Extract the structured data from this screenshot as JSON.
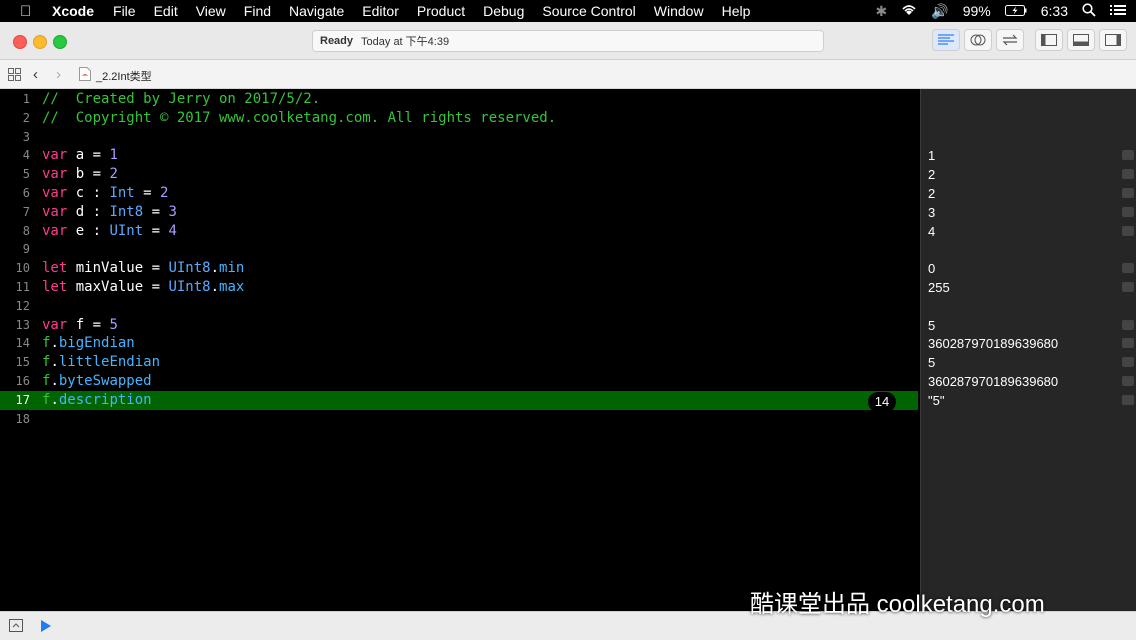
{
  "menubar": {
    "app": "Xcode",
    "items": [
      "File",
      "Edit",
      "View",
      "Find",
      "Navigate",
      "Editor",
      "Product",
      "Debug",
      "Source Control",
      "Window",
      "Help"
    ],
    "battery": "99%",
    "time": "6:33"
  },
  "titlebar": {
    "status_ready": "Ready",
    "status_time": "Today at 下午4:39"
  },
  "pathbar": {
    "file": "_2.2Int类型"
  },
  "lines": [
    {
      "n": "1",
      "tokens": [
        {
          "c": "cmt",
          "t": "//  Created by Jerry on 2017/5/2."
        }
      ]
    },
    {
      "n": "2",
      "tokens": [
        {
          "c": "cmt",
          "t": "//  Copyright © 2017 www.coolketang.com. All rights reserved."
        }
      ]
    },
    {
      "n": "3",
      "tokens": []
    },
    {
      "n": "4",
      "tokens": [
        {
          "c": "kw",
          "t": "var"
        },
        {
          "c": "ident",
          "t": " a = "
        },
        {
          "c": "num-l",
          "t": "1"
        }
      ]
    },
    {
      "n": "5",
      "tokens": [
        {
          "c": "kw",
          "t": "var"
        },
        {
          "c": "ident",
          "t": " b = "
        },
        {
          "c": "num-l",
          "t": "2"
        }
      ]
    },
    {
      "n": "6",
      "tokens": [
        {
          "c": "kw",
          "t": "var"
        },
        {
          "c": "ident",
          "t": " c : "
        },
        {
          "c": "type",
          "t": "Int"
        },
        {
          "c": "ident",
          "t": " = "
        },
        {
          "c": "num-l",
          "t": "2"
        }
      ]
    },
    {
      "n": "7",
      "tokens": [
        {
          "c": "kw",
          "t": "var"
        },
        {
          "c": "ident",
          "t": " d : "
        },
        {
          "c": "type",
          "t": "Int8"
        },
        {
          "c": "ident",
          "t": " = "
        },
        {
          "c": "num-l",
          "t": "3"
        }
      ]
    },
    {
      "n": "8",
      "tokens": [
        {
          "c": "kw",
          "t": "var"
        },
        {
          "c": "ident",
          "t": " e : "
        },
        {
          "c": "type",
          "t": "UInt"
        },
        {
          "c": "ident",
          "t": " = "
        },
        {
          "c": "num-l",
          "t": "4"
        }
      ]
    },
    {
      "n": "9",
      "tokens": []
    },
    {
      "n": "10",
      "tokens": [
        {
          "c": "kw",
          "t": "let"
        },
        {
          "c": "ident",
          "t": " minValue = "
        },
        {
          "c": "type",
          "t": "UInt8"
        },
        {
          "c": "ident",
          "t": "."
        },
        {
          "c": "prop",
          "t": "min"
        }
      ]
    },
    {
      "n": "11",
      "tokens": [
        {
          "c": "kw",
          "t": "let"
        },
        {
          "c": "ident",
          "t": " maxValue = "
        },
        {
          "c": "type",
          "t": "UInt8"
        },
        {
          "c": "ident",
          "t": "."
        },
        {
          "c": "prop",
          "t": "max"
        }
      ]
    },
    {
      "n": "12",
      "tokens": []
    },
    {
      "n": "13",
      "tokens": [
        {
          "c": "kw",
          "t": "var"
        },
        {
          "c": "ident",
          "t": " f = "
        },
        {
          "c": "num-l",
          "t": "5"
        }
      ]
    },
    {
      "n": "14",
      "tokens": [
        {
          "c": "cmt",
          "t": "f"
        },
        {
          "c": "ident",
          "t": "."
        },
        {
          "c": "prop",
          "t": "bigEndian"
        }
      ]
    },
    {
      "n": "15",
      "tokens": [
        {
          "c": "cmt",
          "t": "f"
        },
        {
          "c": "ident",
          "t": "."
        },
        {
          "c": "prop",
          "t": "littleEndian"
        }
      ]
    },
    {
      "n": "16",
      "tokens": [
        {
          "c": "cmt",
          "t": "f"
        },
        {
          "c": "ident",
          "t": "."
        },
        {
          "c": "prop",
          "t": "byteSwapped"
        }
      ]
    },
    {
      "n": "17",
      "tokens": [
        {
          "c": "cmt",
          "t": "f"
        },
        {
          "c": "ident",
          "t": "."
        },
        {
          "c": "prop",
          "t": "description"
        }
      ],
      "highlight": true
    },
    {
      "n": "18",
      "tokens": []
    }
  ],
  "results": [
    {
      "line": "4",
      "value": "1"
    },
    {
      "line": "5",
      "value": "2"
    },
    {
      "line": "6",
      "value": "2"
    },
    {
      "line": "7",
      "value": "3"
    },
    {
      "line": "8",
      "value": "4"
    },
    {
      "line": "10",
      "value": "0"
    },
    {
      "line": "11",
      "value": "255"
    },
    {
      "line": "13",
      "value": "5"
    },
    {
      "line": "14",
      "value": "360287970189639680"
    },
    {
      "line": "15",
      "value": "5"
    },
    {
      "line": "16",
      "value": "360287970189639680"
    },
    {
      "line": "17",
      "value": "\"5\""
    }
  ],
  "badge": "14",
  "watermark": "酷课堂出品 coolketang.com"
}
